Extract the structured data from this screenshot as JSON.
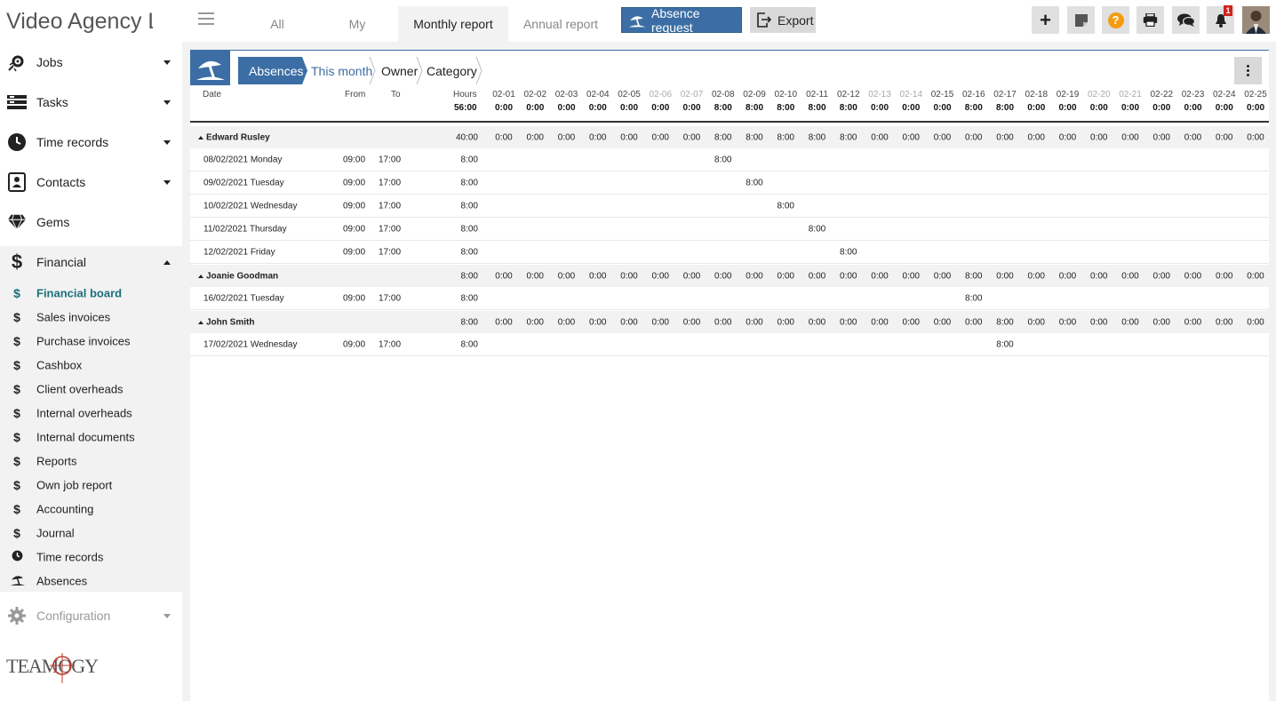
{
  "app": {
    "title": "Video Agency Ltd"
  },
  "sidebar": {
    "items": [
      {
        "label": "Jobs",
        "icon": "jobs-gear-icon"
      },
      {
        "label": "Tasks",
        "icon": "tasks-list-icon"
      },
      {
        "label": "Time records",
        "icon": "clock-icon"
      },
      {
        "label": "Contacts",
        "icon": "contact-card-icon"
      },
      {
        "label": "Gems",
        "icon": "diamond-icon"
      },
      {
        "label": "Financial",
        "icon": "dollar-icon"
      }
    ],
    "financial_sub": [
      {
        "label": "Financial board",
        "glyph": "$"
      },
      {
        "label": "Sales invoices",
        "glyph": "$"
      },
      {
        "label": "Purchase invoices",
        "glyph": "$"
      },
      {
        "label": "Cashbox",
        "glyph": "$"
      },
      {
        "label": "Client overheads",
        "glyph": "$"
      },
      {
        "label": "Internal overheads",
        "glyph": "$"
      },
      {
        "label": "Internal documents",
        "glyph": "$"
      },
      {
        "label": "Reports",
        "glyph": "$"
      },
      {
        "label": "Own job report",
        "glyph": "$"
      },
      {
        "label": "Accounting",
        "glyph": "$"
      },
      {
        "label": "Journal",
        "glyph": "$"
      },
      {
        "label": "Time records",
        "glyph": "clock"
      },
      {
        "label": "Absences",
        "glyph": "umbrella"
      }
    ],
    "configuration": "Configuration",
    "logo_text": "TEAMOGY"
  },
  "topbar": {
    "tabs": [
      "All",
      "My",
      "Monthly report",
      "Annual report"
    ],
    "active_tab": "Monthly report",
    "absence_request": "Absence request",
    "export": "Export",
    "notification_count": "1"
  },
  "breadcrumb": [
    "Absences",
    "This month",
    "Owner",
    "Category"
  ],
  "table": {
    "headers": {
      "date": "Date",
      "from": "From",
      "to": "To",
      "hours": "Hours",
      "total_hours": "56:00"
    },
    "days": [
      "02-01",
      "02-02",
      "02-03",
      "02-04",
      "02-05",
      "02-06",
      "02-07",
      "02-08",
      "02-09",
      "02-10",
      "02-11",
      "02-12",
      "02-13",
      "02-14",
      "02-15",
      "02-16",
      "02-17",
      "02-18",
      "02-19",
      "02-20",
      "02-21",
      "02-22",
      "02-23",
      "02-24",
      "02-25"
    ],
    "weekend": [
      false,
      false,
      false,
      false,
      false,
      true,
      true,
      false,
      false,
      false,
      false,
      false,
      true,
      true,
      false,
      false,
      false,
      false,
      false,
      true,
      true,
      false,
      false,
      false,
      false
    ],
    "day_totals": [
      "0:00",
      "0:00",
      "0:00",
      "0:00",
      "0:00",
      "0:00",
      "0:00",
      "8:00",
      "8:00",
      "8:00",
      "8:00",
      "8:00",
      "0:00",
      "0:00",
      "0:00",
      "8:00",
      "8:00",
      "0:00",
      "0:00",
      "0:00",
      "0:00",
      "0:00",
      "0:00",
      "0:00",
      "0:00"
    ],
    "groups": [
      {
        "name": "Edward Rusley",
        "hours": "40:00",
        "day_values": [
          "0:00",
          "0:00",
          "0:00",
          "0:00",
          "0:00",
          "0:00",
          "0:00",
          "8:00",
          "8:00",
          "8:00",
          "8:00",
          "8:00",
          "0:00",
          "0:00",
          "0:00",
          "0:00",
          "0:00",
          "0:00",
          "0:00",
          "0:00",
          "0:00",
          "0:00",
          "0:00",
          "0:00",
          "0:00"
        ],
        "rows": [
          {
            "date": "08/02/2021 Monday",
            "from": "09:00",
            "to": "17:00",
            "hours": "8:00",
            "day_index": 7,
            "value": "8:00"
          },
          {
            "date": "09/02/2021 Tuesday",
            "from": "09:00",
            "to": "17:00",
            "hours": "8:00",
            "day_index": 8,
            "value": "8:00"
          },
          {
            "date": "10/02/2021 Wednesday",
            "from": "09:00",
            "to": "17:00",
            "hours": "8:00",
            "day_index": 9,
            "value": "8:00"
          },
          {
            "date": "11/02/2021 Thursday",
            "from": "09:00",
            "to": "17:00",
            "hours": "8:00",
            "day_index": 10,
            "value": "8:00"
          },
          {
            "date": "12/02/2021 Friday",
            "from": "09:00",
            "to": "17:00",
            "hours": "8:00",
            "day_index": 11,
            "value": "8:00"
          }
        ]
      },
      {
        "name": "Joanie Goodman",
        "hours": "8:00",
        "day_values": [
          "0:00",
          "0:00",
          "0:00",
          "0:00",
          "0:00",
          "0:00",
          "0:00",
          "0:00",
          "0:00",
          "0:00",
          "0:00",
          "0:00",
          "0:00",
          "0:00",
          "0:00",
          "8:00",
          "0:00",
          "0:00",
          "0:00",
          "0:00",
          "0:00",
          "0:00",
          "0:00",
          "0:00",
          "0:00"
        ],
        "rows": [
          {
            "date": "16/02/2021 Tuesday",
            "from": "09:00",
            "to": "17:00",
            "hours": "8:00",
            "day_index": 15,
            "value": "8:00"
          }
        ]
      },
      {
        "name": "John Smith",
        "hours": "8:00",
        "day_values": [
          "0:00",
          "0:00",
          "0:00",
          "0:00",
          "0:00",
          "0:00",
          "0:00",
          "0:00",
          "0:00",
          "0:00",
          "0:00",
          "0:00",
          "0:00",
          "0:00",
          "0:00",
          "0:00",
          "8:00",
          "0:00",
          "0:00",
          "0:00",
          "0:00",
          "0:00",
          "0:00",
          "0:00",
          "0:00"
        ],
        "rows": [
          {
            "date": "17/02/2021 Wednesday",
            "from": "09:00",
            "to": "17:00",
            "hours": "8:00",
            "day_index": 16,
            "value": "8:00"
          }
        ]
      }
    ]
  }
}
